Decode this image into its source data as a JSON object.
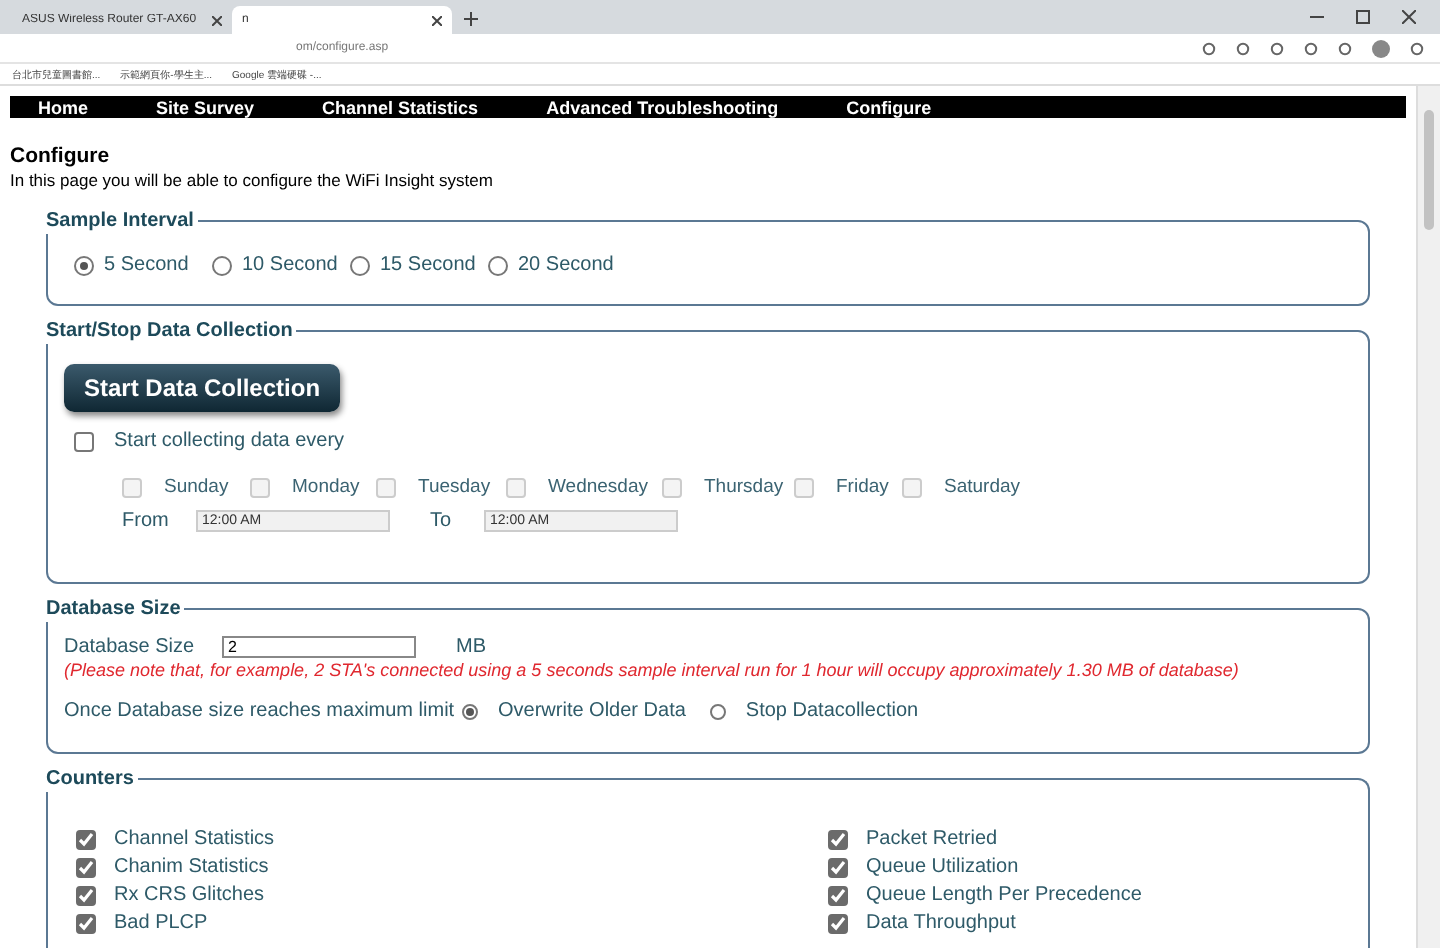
{
  "browser": {
    "tabs": [
      {
        "title": "ASUS Wireless Router GT-AX60",
        "selected": false
      },
      {
        "title": "n",
        "selected": true
      }
    ],
    "address": "om/configure.asp",
    "bookmarks": [
      "台北市兒童圖書館...",
      "示範網頁你-學生主...",
      "Google 雲端硬碟 -..."
    ]
  },
  "nav": [
    {
      "label": "Home"
    },
    {
      "label": "Site Survey"
    },
    {
      "label": "Channel Statistics"
    },
    {
      "label": "Advanced Troubleshooting"
    },
    {
      "label": "Configure"
    }
  ],
  "page": {
    "title": "Configure",
    "subtitle": "In this page you will be able to configure the WiFi Insight system"
  },
  "sample_interval": {
    "legend": "Sample Interval",
    "options": [
      {
        "label": "5 Second",
        "selected": true
      },
      {
        "label": "10 Second",
        "selected": false
      },
      {
        "label": "15 Second",
        "selected": false
      },
      {
        "label": "20 Second",
        "selected": false
      }
    ]
  },
  "collection": {
    "legend": "Start/Stop Data Collection",
    "button": "Start Data Collection",
    "schedule": {
      "label": "Start collecting data every",
      "checked": false
    },
    "days": [
      {
        "label": "Sunday",
        "checked": false,
        "disabled": true
      },
      {
        "label": "Monday",
        "checked": false,
        "disabled": true
      },
      {
        "label": "Tuesday",
        "checked": false,
        "disabled": true
      },
      {
        "label": "Wednesday",
        "checked": false,
        "disabled": true
      },
      {
        "label": "Thursday",
        "checked": false,
        "disabled": true
      },
      {
        "label": "Friday",
        "checked": false,
        "disabled": true
      },
      {
        "label": "Saturday",
        "checked": false,
        "disabled": true
      }
    ],
    "from_label": "From",
    "from_value": "12:00 AM",
    "to_label": "To",
    "to_value": "12:00 AM"
  },
  "database": {
    "legend": "Database Size",
    "size_label": "Database Size",
    "size_value": "2",
    "unit": "MB",
    "note": "(Please note that, for example, 2 STA's connected using a 5 seconds sample interval run for 1 hour will occupy approximately 1.30 MB of database)",
    "limit_label": "Once Database size reaches maximum limit",
    "options": [
      {
        "label": "Overwrite Older Data",
        "selected": true
      },
      {
        "label": "Stop Datacollection",
        "selected": false
      }
    ]
  },
  "counters": {
    "legend": "Counters",
    "left": [
      {
        "label": "Channel Statistics",
        "checked": true
      },
      {
        "label": "Chanim Statistics",
        "checked": true
      },
      {
        "label": "Rx CRS Glitches",
        "checked": true
      },
      {
        "label": "Bad PLCP",
        "checked": true
      }
    ],
    "right": [
      {
        "label": "Packet Retried",
        "checked": true
      },
      {
        "label": "Queue Utilization",
        "checked": true
      },
      {
        "label": "Queue Length Per Precedence",
        "checked": true
      },
      {
        "label": "Data Throughput",
        "checked": true
      }
    ]
  }
}
